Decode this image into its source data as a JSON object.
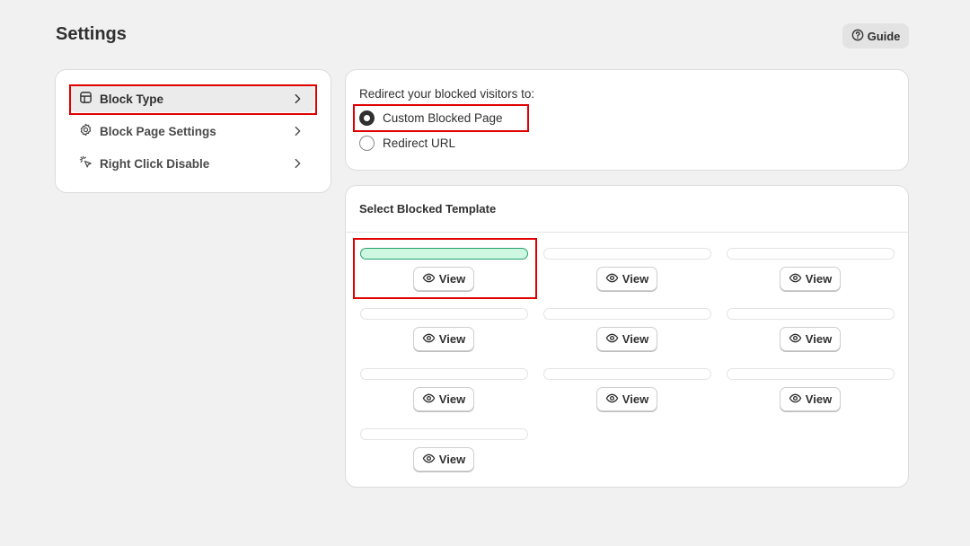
{
  "page": {
    "title": "Settings"
  },
  "header": {
    "guide_label": "Guide"
  },
  "sidebar": {
    "items": [
      {
        "label": "Block Type",
        "icon": "layout-icon",
        "active": true
      },
      {
        "label": "Block Page Settings",
        "icon": "gear-icon",
        "active": false
      },
      {
        "label": "Right Click Disable",
        "icon": "cursor-click-icon",
        "active": false
      }
    ]
  },
  "redirect": {
    "heading": "Redirect your blocked visitors to:",
    "options": [
      {
        "label": "Custom Blocked Page",
        "checked": true
      },
      {
        "label": "Redirect URL",
        "checked": false
      }
    ]
  },
  "templates": {
    "heading": "Select Blocked Template",
    "view_label": "View",
    "count": 10,
    "selected_index": 0,
    "selected_color": "#cdf7e1"
  },
  "colors": {
    "highlight": "#e00000",
    "background": "#f1f1f2"
  }
}
